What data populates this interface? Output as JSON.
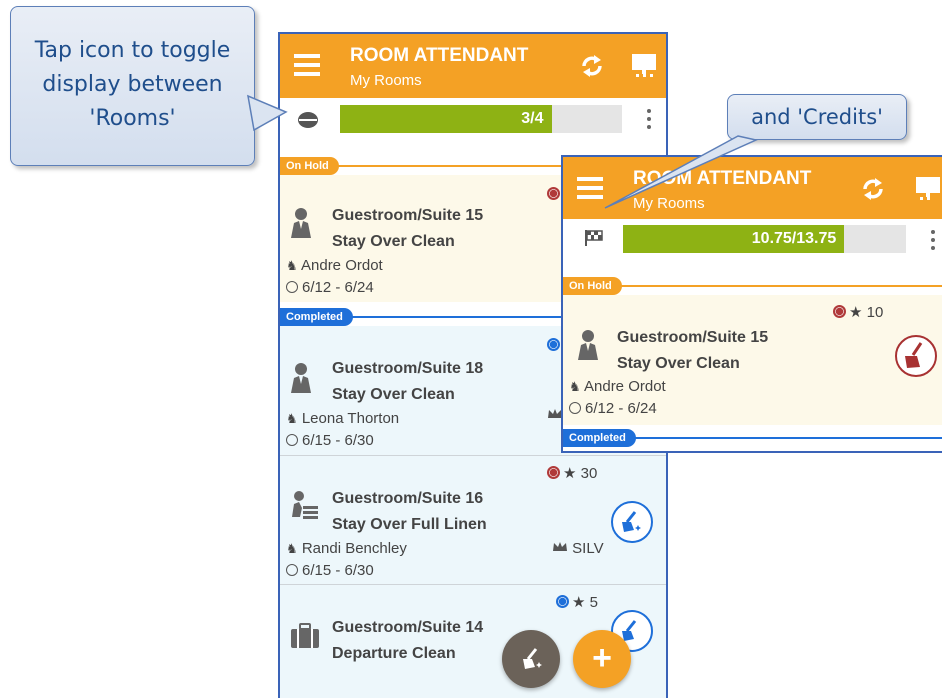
{
  "callouts": {
    "rooms_toggle": [
      "Tap icon to toggle",
      "display between",
      "'Rooms'"
    ],
    "credits": "and 'Credits'"
  },
  "app": {
    "title": "ROOM ATTENDANT",
    "subtitle": "My Rooms"
  },
  "colors": {
    "header": "#f4a125",
    "progress": "#8eb214",
    "on_hold": "#f4a125",
    "completed": "#1e6fd9",
    "priority_red": "#b03a3a",
    "priority_blue": "#1e6fd9"
  },
  "screen_rooms": {
    "progress_text": "3/4",
    "progress_fraction": 0.75,
    "status_on_hold": "On Hold",
    "status_completed": "Completed",
    "rooms": [
      {
        "room": "Guestroom/Suite 15",
        "clean_type": "Stay Over Clean",
        "guest": "Andre Ordot",
        "dates": "6/12 - 6/24",
        "priority_color": "red",
        "status": "on_hold",
        "icon": "attendant-icon"
      },
      {
        "room": "Guestroom/Suite 18",
        "clean_type": "Stay Over Clean",
        "guest": "Leona Thorton",
        "dates": "6/15 - 6/30",
        "priority_color": "blue",
        "status": "completed",
        "icon": "attendant-icon",
        "vip_icon": "crown-icon"
      },
      {
        "room": "Guestroom/Suite 16",
        "clean_type": "Stay Over Full Linen",
        "guest": "Randi Benchley",
        "dates": "6/15 - 6/30",
        "priority_color": "red",
        "priority_points": "30",
        "vip": "SILV",
        "icon": "linen-icon",
        "action_icon": "broom-sparkle-icon"
      },
      {
        "room": "Guestroom/Suite 14",
        "clean_type": "Departure Clean",
        "priority_color": "blue",
        "priority_points": "5",
        "icon": "luggage-icon",
        "action_icon": "broom-sparkle-icon"
      }
    ],
    "fab_clean_icon": "broom-sparkle-icon",
    "fab_add_label": "+"
  },
  "screen_credits": {
    "progress_text": "10.75/13.75",
    "progress_fraction": 0.782,
    "status_on_hold": "On Hold",
    "status_completed": "Completed",
    "room": {
      "room": "Guestroom/Suite 15",
      "clean_type": "Stay Over Clean",
      "guest": "Andre Ordot",
      "dates": "6/12 - 6/24",
      "priority_color": "red",
      "priority_points": "10",
      "action_icon": "broom-icon"
    },
    "toggle_icon": "checkered-flag-icon"
  }
}
